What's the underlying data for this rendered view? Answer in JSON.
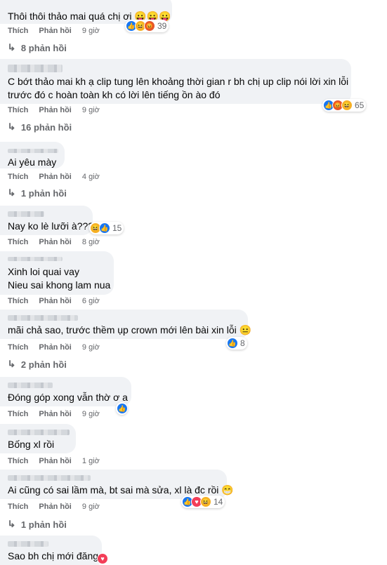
{
  "actions": {
    "like": "Thích",
    "reply": "Phản hồi"
  },
  "comments": [
    {
      "lines": [
        "Thôi thôi thảo mai quá chị ơi 😛😛😛"
      ],
      "time": "9 giờ",
      "reaction_count": "39",
      "reactions": [
        "like-icon",
        "haha-icon",
        "angry-icon"
      ],
      "replies": "8 phản hồi"
    },
    {
      "lines": [
        "C bớt thảo mai kh ạ clip tung lên khoảng thời gian r bh chị up clip nói lời xin lỗi",
        "trước đó c hoàn toàn kh có lời lên tiếng ồn ào đó"
      ],
      "time": "9 giờ",
      "reaction_count": "65",
      "reactions": [
        "like-icon",
        "angry-icon",
        "haha-icon"
      ],
      "replies": "16 phản hồi"
    },
    {
      "lines": [
        "Ai yêu mày"
      ],
      "time": "4 giờ",
      "reaction_count": "",
      "reactions": [],
      "replies": "1 phản hồi"
    },
    {
      "lines": [
        "Nay ko lè lưỡi à???"
      ],
      "time": "8 giờ",
      "reaction_count": "15",
      "reactions": [
        "haha-icon",
        "like-icon"
      ],
      "replies": ""
    },
    {
      "lines": [
        "Xinh loi quai vay",
        "Nieu sai khong lam nua"
      ],
      "time": "6 giờ",
      "reaction_count": "",
      "reactions": [],
      "replies": ""
    },
    {
      "lines": [
        "mãi chả sao, trước thềm ụp crown mới lên bài xin lỗi 😐"
      ],
      "time": "9 giờ",
      "reaction_count": "8",
      "reactions": [
        "like-icon"
      ],
      "replies": "2 phản hồi"
    },
    {
      "lines": [
        "Đóng góp xong vẫn thờ ơ a"
      ],
      "time": "9 giờ",
      "reaction_count": "",
      "reactions": [
        "like-icon"
      ],
      "replies": ""
    },
    {
      "lines": [
        "Bống xl rồi"
      ],
      "time": "1 giờ",
      "reaction_count": "",
      "reactions": [],
      "replies": ""
    },
    {
      "lines": [
        "Ai cũng có sai lầm mà, bt sai mà sửa, xl là đc rồi 😁"
      ],
      "time": "9 giờ",
      "reaction_count": "14",
      "reactions": [
        "like-icon",
        "love-icon",
        "haha-icon"
      ],
      "replies": "1 phản hồi"
    },
    {
      "lines": [
        "Sao bh chị mới đăng"
      ],
      "time": "",
      "reaction_count": "",
      "reactions": [
        "love-icon"
      ],
      "replies": ""
    }
  ]
}
